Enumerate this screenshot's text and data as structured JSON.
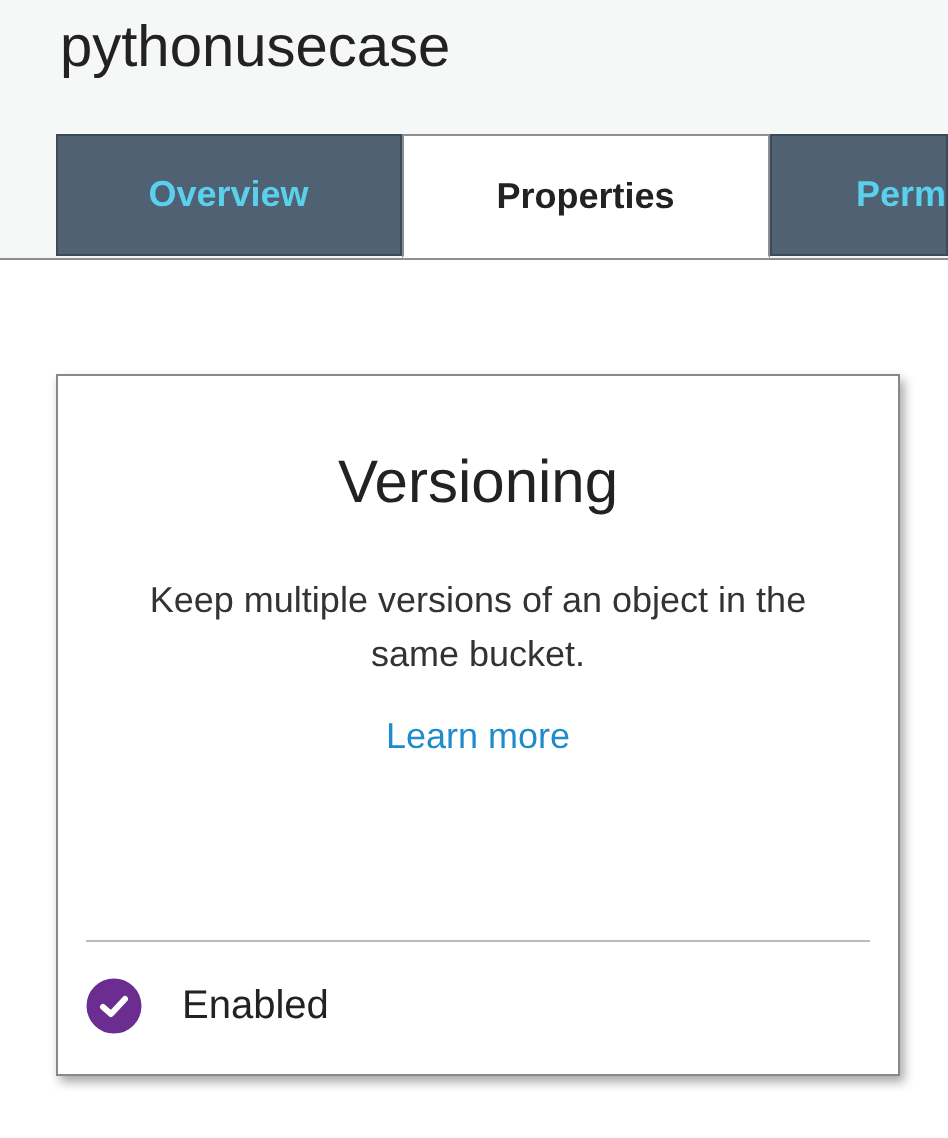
{
  "bucket": {
    "title": "pythonusecase"
  },
  "tabs": [
    {
      "label": "Overview",
      "selected": false
    },
    {
      "label": "Properties",
      "selected": true
    },
    {
      "label": "Perm",
      "selected": false
    }
  ],
  "card": {
    "title": "Versioning",
    "description": "Keep multiple versions of an object in the same bucket.",
    "link": "Learn more",
    "status": {
      "label": "Enabled",
      "enabled": true
    }
  }
}
